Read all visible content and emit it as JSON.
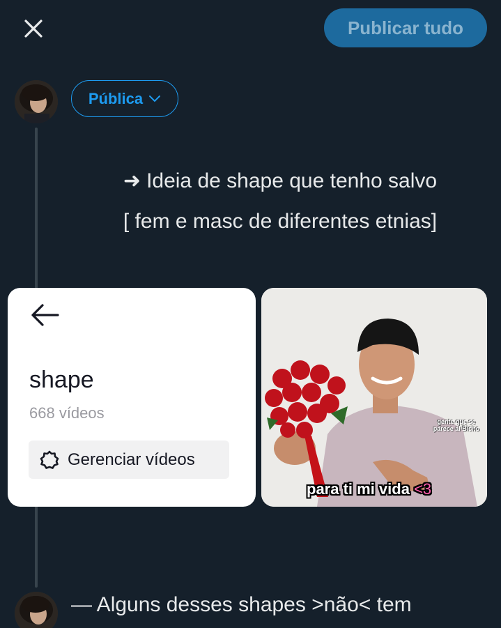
{
  "header": {
    "close_icon": "close-icon",
    "publish_label": "Publicar tudo"
  },
  "post1": {
    "audience_label": "Pública",
    "audience_icon": "chevron-down-icon",
    "text_line_1_arrow": "➜",
    "text_line_1": "Ideia de shape que tenho salvo",
    "text_line_2": "[ fem e masc de diferentes etnias]",
    "media": [
      {
        "type": "screenshot",
        "title": "shape",
        "count": "668 vídeos",
        "button_label": "Gerenciar vídeos",
        "back_icon": "back-arrow-icon",
        "gear_icon": "gear-icon"
      },
      {
        "type": "meme-photo",
        "caption": "para ti mi vida",
        "caption_heart": "<3",
        "watermark": "gente que se parece al Bicho"
      }
    ]
  },
  "post2": {
    "text": "— Alguns desses shapes >não< tem"
  },
  "colors": {
    "background": "#15202b",
    "accent": "#1d9bf0",
    "publish_button": "#1d6a9e",
    "thread_line": "#38444d"
  }
}
